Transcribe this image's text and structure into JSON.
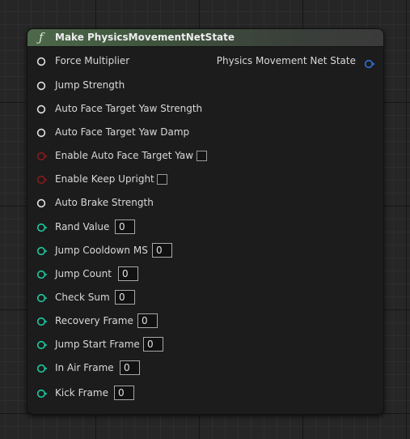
{
  "node": {
    "title": "Make PhysicsMovementNetState",
    "icon": "function-icon",
    "output": {
      "label": "Physics Movement Net State",
      "pin_color": "#2f72e0"
    },
    "colors": {
      "header_accent": "#4d684a",
      "bool_pin": "#8c1a1a",
      "int_pin": "#1fc9a0",
      "float_pin": "#e0e0e0",
      "struct_pin": "#2f72e0"
    },
    "inputs": [
      {
        "label": "Force Multiplier",
        "type": "float"
      },
      {
        "label": "Jump Strength",
        "type": "float"
      },
      {
        "label": "Auto Face Target Yaw Strength",
        "type": "float"
      },
      {
        "label": "Auto Face Target Yaw Damp",
        "type": "float"
      },
      {
        "label": "Enable Auto Face Target Yaw",
        "type": "bool",
        "checked": false
      },
      {
        "label": "Enable Keep Upright",
        "type": "bool",
        "checked": false
      },
      {
        "label": "Auto Brake Strength",
        "type": "float"
      },
      {
        "label": "Rand Value",
        "type": "int",
        "value": "0"
      },
      {
        "label": "Jump Cooldown MS",
        "type": "int",
        "value": "0"
      },
      {
        "label": "Jump Count",
        "type": "int",
        "value": "0"
      },
      {
        "label": "Check Sum",
        "type": "int",
        "value": "0"
      },
      {
        "label": "Recovery Frame",
        "type": "int",
        "value": "0"
      },
      {
        "label": "Jump Start Frame",
        "type": "int",
        "value": "0"
      },
      {
        "label": "In Air Frame",
        "type": "int",
        "value": "0"
      },
      {
        "label": "Kick Frame",
        "type": "int",
        "value": "0"
      }
    ]
  }
}
